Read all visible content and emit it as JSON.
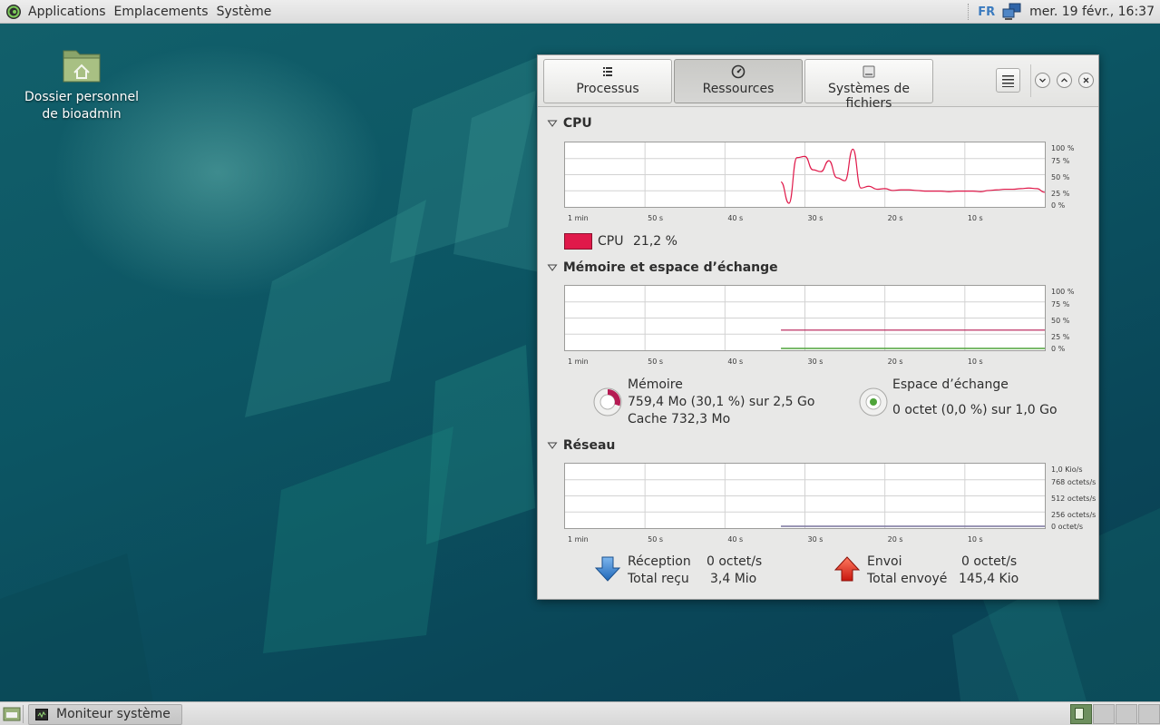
{
  "top_panel": {
    "menus": [
      "Applications",
      "Emplacements",
      "Système"
    ],
    "keyboard_layout": "FR",
    "clock": "mer. 19 févr., 16:37"
  },
  "desktop": {
    "icon_label_line1": "Dossier personnel",
    "icon_label_line2": "de bioadmin"
  },
  "window": {
    "tabs": [
      {
        "label": "Processus",
        "icon": "list-icon",
        "active": false
      },
      {
        "label": "Ressources",
        "icon": "gauge-icon",
        "active": true
      },
      {
        "label": "Systèmes de fichiers",
        "icon": "drive-icon",
        "active": false
      }
    ],
    "x_axis_labels": [
      "1 min",
      "50 s",
      "40 s",
      "30 s",
      "20 s",
      "10 s"
    ],
    "cpu": {
      "title": "CPU",
      "y_axis_labels": [
        "100 %",
        "75 %",
        "50 %",
        "25 %",
        "0 %"
      ],
      "legend_label": "CPU",
      "legend_value": "21,2 %",
      "color": "#e0194a"
    },
    "memory": {
      "title": "Mémoire et espace d’échange",
      "y_axis_labels": [
        "100 %",
        "75 %",
        "50 %",
        "25 %",
        "0 %"
      ],
      "mem_label": "Mémoire",
      "mem_value": "759,4 Mo (30,1 %) sur 2,5 Go",
      "mem_cache": "Cache 732,3 Mo",
      "swap_label": "Espace d’échange",
      "swap_value": "0 octet (0,0 %) sur 1,0 Go",
      "mem_color": "#b51a53",
      "swap_color": "#4fa43a"
    },
    "network": {
      "title": "Réseau",
      "y_axis_labels": [
        "1,0 Kio/s",
        "768 octets/s",
        "512 octets/s",
        "256 octets/s",
        "0 octet/s"
      ],
      "recv_label": "Réception",
      "recv_value": "0 octet/s",
      "recv_total_label": "Total reçu",
      "recv_total_value": "3,4 Mio",
      "send_label": "Envoi",
      "send_value": "0 octet/s",
      "send_total_label": "Total envoyé",
      "send_total_value": "145,4 Kio",
      "recv_color": "#2d7fd1",
      "send_color": "#e0261b"
    }
  },
  "taskbar": {
    "task_label": "Moniteur système",
    "workspaces": 4,
    "active_workspace": 1
  },
  "chart_data": [
    {
      "type": "line",
      "title": "CPU",
      "x": [
        33,
        32,
        31,
        30,
        29,
        28,
        27,
        26,
        25,
        24,
        23,
        22,
        21,
        20,
        19,
        18,
        17,
        16,
        15,
        14,
        13,
        12,
        11,
        10,
        9,
        8,
        7,
        6,
        5,
        4,
        3,
        2,
        1,
        0
      ],
      "x_labels": [
        "1 min",
        "50 s",
        "40 s",
        "30 s",
        "20 s",
        "10 s"
      ],
      "series": [
        {
          "name": "CPU",
          "values": [
            38,
            3,
            78,
            80,
            58,
            55,
            73,
            45,
            40,
            92,
            28,
            31,
            26,
            27,
            24,
            25,
            25,
            24,
            23,
            23,
            23,
            22,
            23,
            23,
            23,
            22,
            24,
            25,
            26,
            26,
            27,
            28,
            27,
            21
          ]
        }
      ],
      "ylim": [
        0,
        100
      ],
      "y_ticks": [
        "100 %",
        "75 %",
        "50 %",
        "25 %",
        "0 %"
      ],
      "grid": true
    },
    {
      "type": "line",
      "title": "Mémoire et espace d’échange",
      "x": [
        33,
        0
      ],
      "x_labels": [
        "1 min",
        "50 s",
        "40 s",
        "30 s",
        "20 s",
        "10 s"
      ],
      "series": [
        {
          "name": "Mémoire",
          "values": [
            30.1,
            30.1
          ]
        },
        {
          "name": "Espace d’échange",
          "values": [
            0,
            0
          ]
        }
      ],
      "ylim": [
        0,
        100
      ],
      "y_ticks": [
        "100 %",
        "75 %",
        "50 %",
        "25 %",
        "0 %"
      ],
      "grid": true
    },
    {
      "type": "line",
      "title": "Réseau",
      "x": [
        33,
        0
      ],
      "x_labels": [
        "1 min",
        "50 s",
        "40 s",
        "30 s",
        "20 s",
        "10 s"
      ],
      "series": [
        {
          "name": "Réception",
          "values": [
            0,
            0
          ]
        },
        {
          "name": "Envoi",
          "values": [
            0,
            0
          ]
        }
      ],
      "ylim": [
        0,
        1024
      ],
      "y_ticks": [
        "1,0 Kio/s",
        "768 octets/s",
        "512 octets/s",
        "256 octets/s",
        "0 octet/s"
      ],
      "grid": true
    }
  ]
}
